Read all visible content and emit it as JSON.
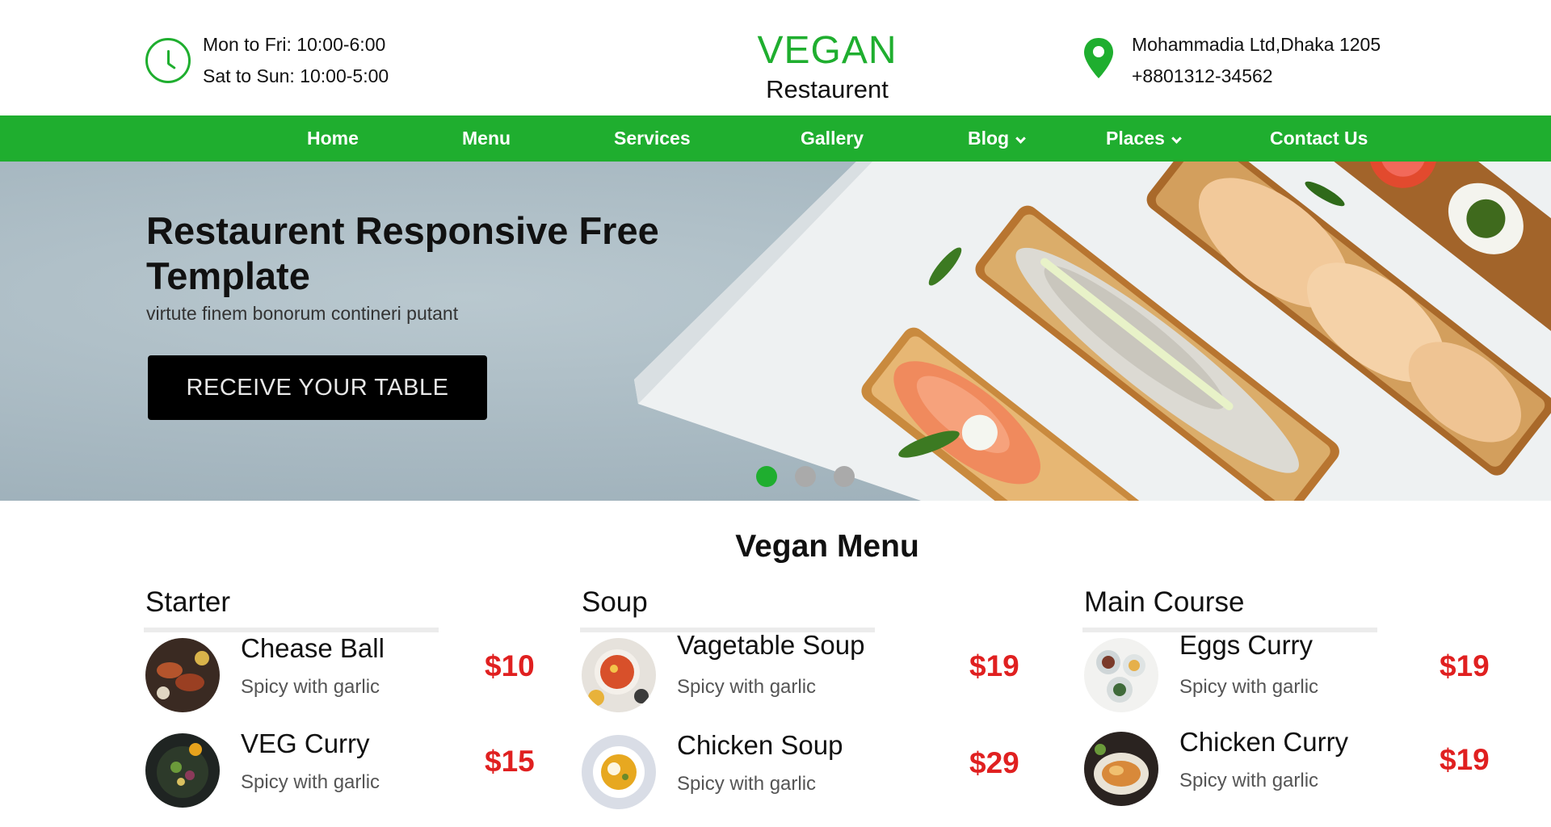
{
  "header": {
    "hours": [
      "Mon to Fri: 10:00-6:00",
      "Sat to Sun: 10:00-5:00"
    ],
    "logo_title": "VEGAN",
    "logo_sub": "Restaurent",
    "address": "Mohammadia Ltd,Dhaka 1205",
    "phone": "+8801312-34562"
  },
  "nav": {
    "items": [
      {
        "label": "Home"
      },
      {
        "label": "Menu"
      },
      {
        "label": "Services"
      },
      {
        "label": "Gallery"
      },
      {
        "label": "Blog",
        "dropdown": true
      },
      {
        "label": "Places",
        "dropdown": true
      },
      {
        "label": "Contact Us"
      }
    ]
  },
  "hero": {
    "title": "Restaurent Responsive Free Template",
    "subtitle": "virtute finem bonorum contineri putant",
    "button": "RECEIVE YOUR TABLE",
    "slides_total": 3,
    "active_slide": 1
  },
  "menu": {
    "title": "Vegan Menu",
    "columns": [
      {
        "title": "Starter",
        "items": [
          {
            "name": "Chease Ball",
            "desc": "Spicy with garlic",
            "price": "$10"
          },
          {
            "name": "VEG Curry",
            "desc": "Spicy with garlic",
            "price": "$15"
          }
        ]
      },
      {
        "title": "Soup",
        "items": [
          {
            "name": "Vagetable Soup",
            "desc": "Spicy with garlic",
            "price": "$19"
          },
          {
            "name": "Chicken Soup",
            "desc": "Spicy with garlic",
            "price": "$29"
          }
        ]
      },
      {
        "title": "Main Course",
        "items": [
          {
            "name": "Eggs Curry",
            "desc": "Spicy with garlic",
            "price": "$19"
          },
          {
            "name": "Chicken Curry",
            "desc": "Spicy with garlic",
            "price": "$19"
          }
        ]
      }
    ]
  },
  "colors": {
    "brand_green": "#1fae2f",
    "price_red": "#e02020",
    "button_black": "#000000"
  }
}
